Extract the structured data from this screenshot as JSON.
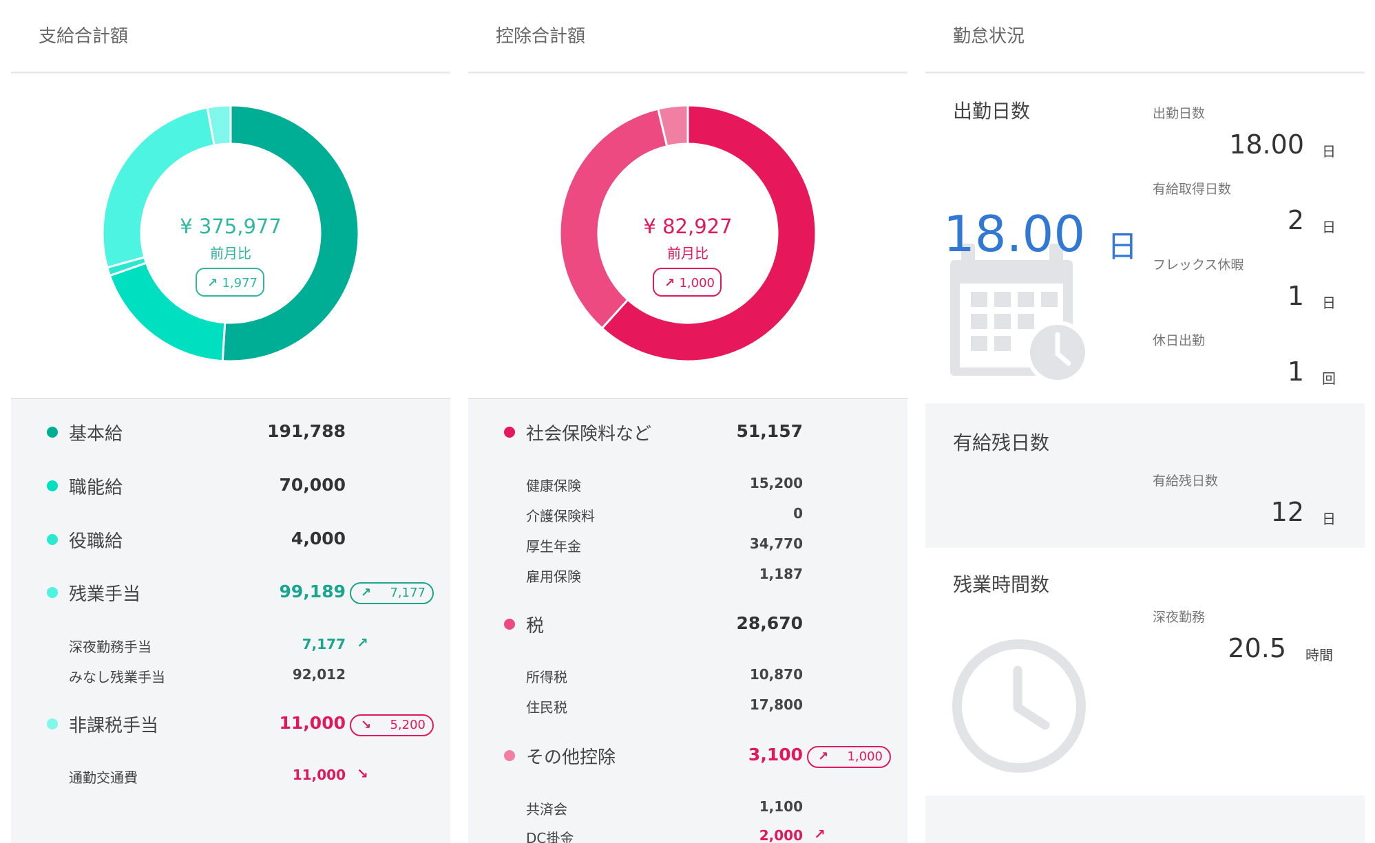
{
  "colors": {
    "pay_dark": "#00ae95",
    "pay_mid": "#00dfc0",
    "pay_light": "#4cf4e1",
    "pay_lighter": "#7ff7ea",
    "ded_dark": "#e6175a",
    "ded_mid": "#ec4a80",
    "ded_light": "#f07fa3",
    "accent_blue": "#3178d4",
    "negative_red": "#e0195a"
  },
  "payments": {
    "title": "支給合計額",
    "total": "¥ 375,977",
    "compare_label": "前月比",
    "compare_arrow": "↗",
    "compare_value": "1,977",
    "items": [
      {
        "label": "基本給",
        "value": "191,788"
      },
      {
        "label": "職能給",
        "value": "70,000"
      },
      {
        "label": "役職給",
        "value": "4,000"
      },
      {
        "label": "残業手当",
        "value": "99,189",
        "badge_arrow": "↗",
        "badge_value": "7,177"
      },
      {
        "label": "非課税手当",
        "value": "11,000",
        "badge_arrow": "↘",
        "badge_value": "5,200"
      }
    ],
    "sub": [
      {
        "label": "深夜勤務手当",
        "value": "7,177",
        "arrow": "↗"
      },
      {
        "label": "みなし残業手当",
        "value": "92,012"
      },
      {
        "label": "通勤交通費",
        "value": "11,000",
        "arrow": "↘"
      }
    ]
  },
  "deductions": {
    "title": "控除合計額",
    "total": "¥ 82,927",
    "compare_label": "前月比",
    "compare_arrow": "↗",
    "compare_value": "1,000",
    "groups": [
      {
        "label": "社会保険料など",
        "value": "51,157"
      },
      {
        "label": "税",
        "value": "28,670"
      },
      {
        "label": "その他控除",
        "value": "3,100",
        "badge_arrow": "↗",
        "badge_value": "1,000"
      }
    ],
    "sub": [
      {
        "label": "健康保険",
        "value": "15,200"
      },
      {
        "label": "介護保険料",
        "value": "0"
      },
      {
        "label": "厚生年金",
        "value": "34,770"
      },
      {
        "label": "雇用保険",
        "value": "1,187"
      },
      {
        "label": "所得税",
        "value": "10,870"
      },
      {
        "label": "住民税",
        "value": "17,800"
      },
      {
        "label": "共済会",
        "value": "1,100"
      },
      {
        "label": "DC掛金",
        "value": "2,000",
        "arrow": "↗"
      }
    ]
  },
  "attendance": {
    "title": "勤怠状況",
    "work_days_heading": "出勤日数",
    "work_days_big": "18.00",
    "work_days_big_unit": "日",
    "details": [
      {
        "label": "出勤日数",
        "value": "18.00",
        "unit": "日"
      },
      {
        "label": "有給取得日数",
        "value": "2",
        "unit": "日"
      },
      {
        "label": "フレックス休暇",
        "value": "1",
        "unit": "日"
      },
      {
        "label": "休日出勤",
        "value": "1",
        "unit": "回"
      }
    ],
    "paid_leave_heading": "有給残日数",
    "paid_leave_label": "有給残日数",
    "paid_leave_value": "12",
    "paid_leave_unit": "日",
    "overtime_heading": "残業時間数",
    "overtime_label": "深夜勤務",
    "overtime_value": "20.5",
    "overtime_unit": "時間"
  }
}
